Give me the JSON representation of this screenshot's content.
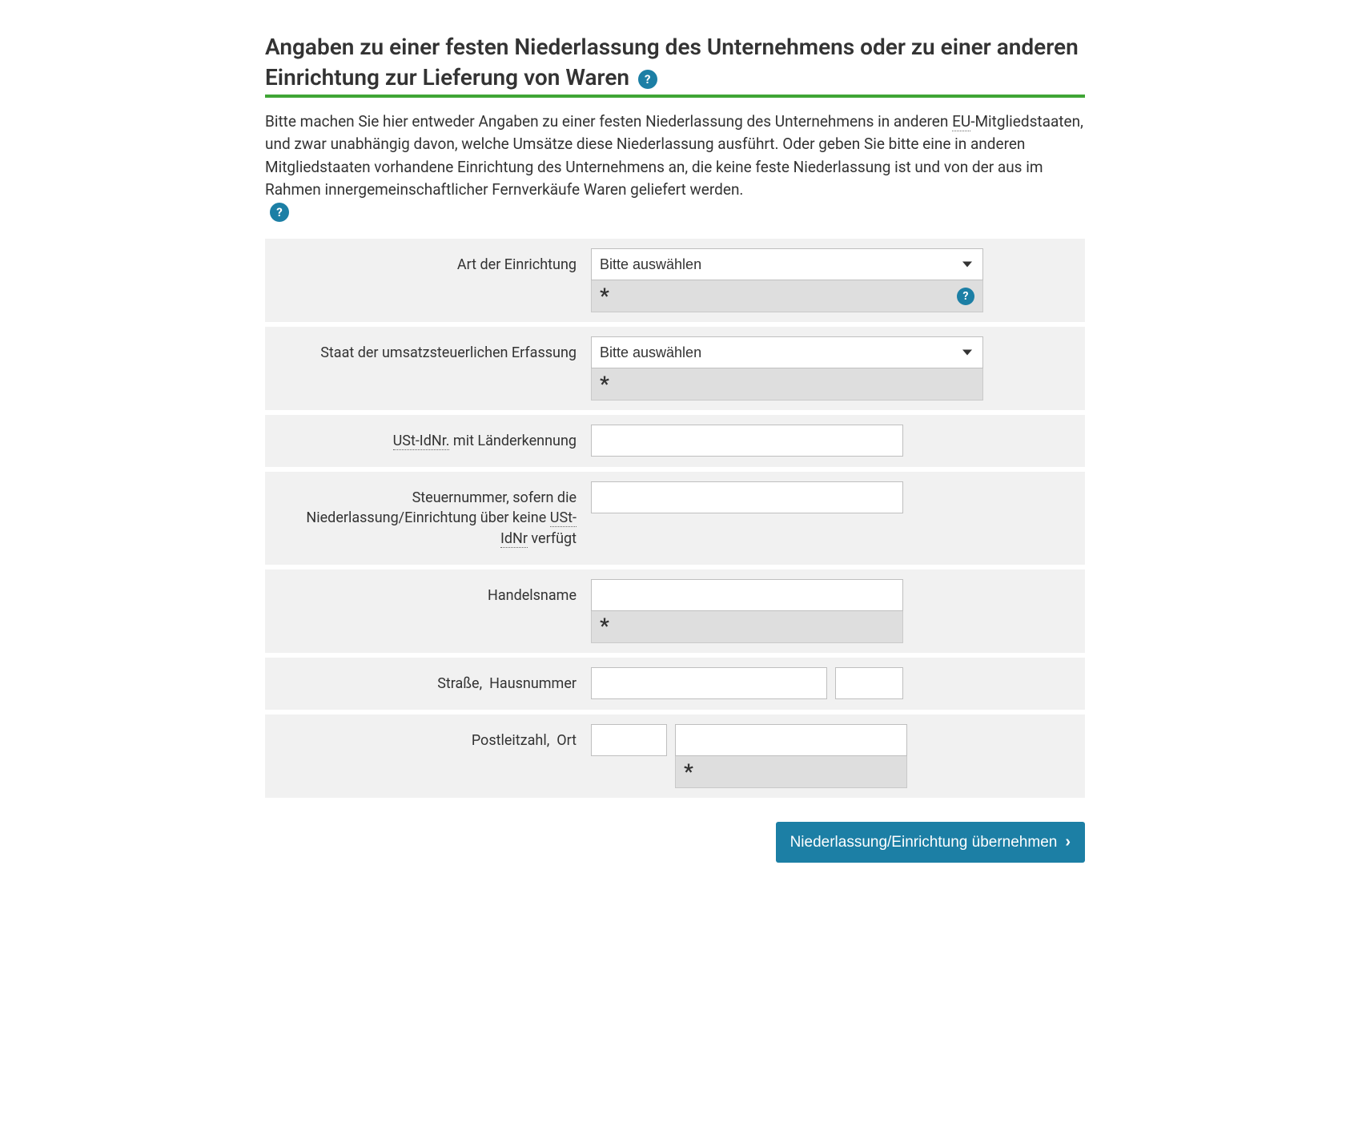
{
  "heading": "Angaben zu einer festen Niederlassung des Unternehmens oder zu einer anderen Einrichtung zur Lieferung von Waren",
  "intro": {
    "part1": "Bitte machen Sie hier entweder Angaben zu einer festen Niederlassung des Unternehmens in anderen ",
    "abbr1": "EU",
    "part2": "-Mitgliedstaaten, und zwar unabhängig davon, welche Umsätze diese Niederlassung ausführt. Oder geben Sie bitte eine in anderen Mitgliedstaaten vorhandene Einrichtung des Unternehmens an, die keine feste Niederlassung ist und von der aus im Rahmen innergemeinschaftlicher Fernverkäufe Waren geliefert werden."
  },
  "fields": {
    "art": {
      "label": "Art der Einrichtung",
      "placeholder": "Bitte auswählen"
    },
    "staat": {
      "label": "Staat der umsatzsteuerlichen Erfassung",
      "placeholder": "Bitte auswählen"
    },
    "ustid": {
      "label_pre": "",
      "abbr": "USt-IdNr.",
      "label_post": " mit Länderkennung"
    },
    "steuernummer": {
      "label_pre": "Steuernummer, sofern die Niederlassung/Einrichtung über keine ",
      "abbr": "USt-IdNr",
      "label_post": " verfügt"
    },
    "handelsname": {
      "label": "Handelsname"
    },
    "strasse": {
      "label_a": "Straße,",
      "label_b": "Hausnummer"
    },
    "plz": {
      "label_a": "Postleitzahl,",
      "label_b": "Ort"
    }
  },
  "help_glyph": "?",
  "asterisk": "*",
  "submit": "Niederlassung/Einrichtung übernehmen",
  "chevron": "›"
}
